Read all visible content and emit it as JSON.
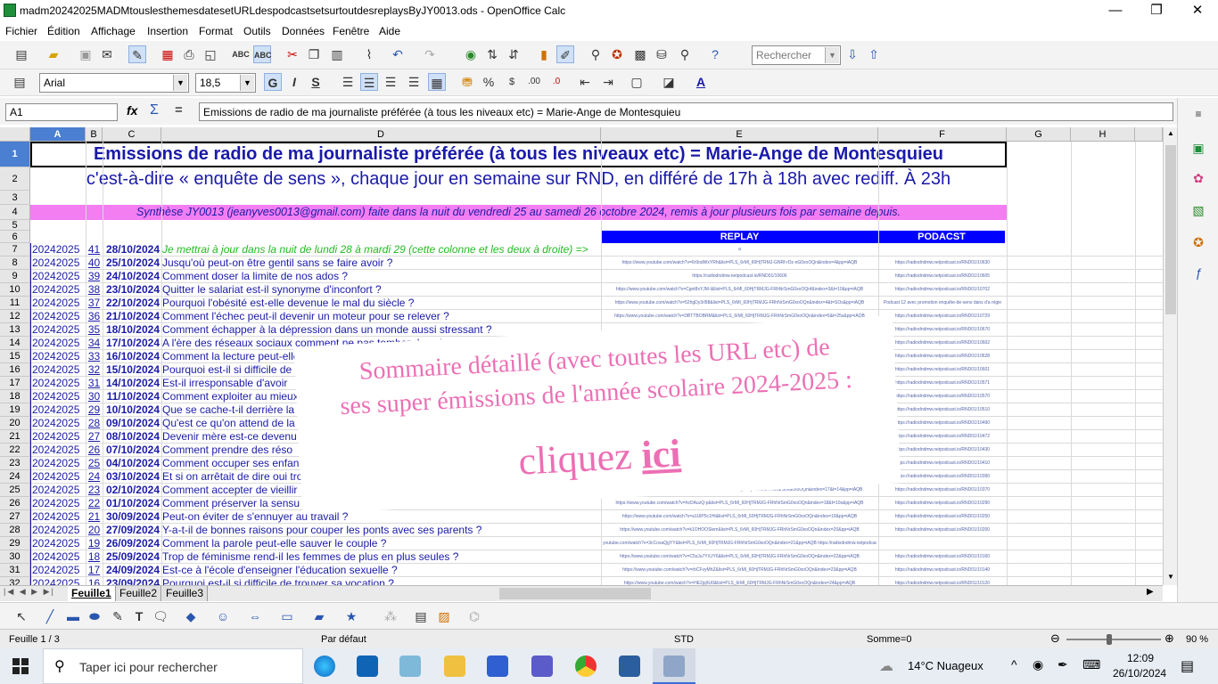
{
  "window": {
    "title": "madm20242025MADMtouslesthemesdatesetURLdespodcastsetsurtoutdesreplaysByJY0013.ods - OpenOffice Calc",
    "minimize": "—",
    "maximize": "❐",
    "close": "✕"
  },
  "menu": [
    "Fichier",
    "Édition",
    "Affichage",
    "Insertion",
    "Format",
    "Outils",
    "Données",
    "Fenêtre",
    "Aide"
  ],
  "toolbar": {
    "search_placeholder": "Rechercher",
    "font_name": "Arial",
    "font_size": "18,5",
    "bold": "G",
    "italic": "I",
    "underline": "S"
  },
  "formula_bar": {
    "cell_ref": "A1",
    "fx_symbol": "fx",
    "sum_symbol": "Σ",
    "equals_symbol": "=",
    "content": "Emissions de radio de ma journaliste préférée (à tous les niveaux etc)  =  Marie-Ange de Montesquieu"
  },
  "columns": [
    "A",
    "B",
    "C",
    "D",
    "E",
    "F",
    "G",
    "H"
  ],
  "sheet": {
    "title": "Emissions de radio de ma journaliste préférée (à tous les niveaux etc)  =  Marie-Ange de Montesquieu",
    "subtitle": "c'est-à-dire « enquête de sens », chaque jour en semaine sur RND, en différé de 17h à 18h avec rediff. À 23h",
    "synthesis": "Synthèse JY0013  (jeanyves0013@gmail.com) faite dans la nuit du vendredi 25 au samedi 26 octobre 2024, remis à jour plusieurs fois par semaine depuis.",
    "replay_header": "REPLAY",
    "podcast_header": "PODACST",
    "rows": [
      {
        "n": "7",
        "year": "20242025",
        "num": "41",
        "date": "28/10/2024",
        "title": "Je mettrai à jour dans la nuit de lundi 28 à mardi 29 (cette colonne et les deux à droite) =>",
        "note": true,
        "replay": "a",
        "podcast": ""
      },
      {
        "n": "8",
        "year": "20242025",
        "num": "40",
        "date": "25/10/2024",
        "title": "Jusqu'où peut-on être gentil sans se faire avoir ?",
        "replay": "https://www.youtube.com/watch?v=6r9odWxYRh&list=PLS_6rMl_60HjTRMJ-GNRf-rDz-nG0xoOQn&index=4&pp=iAQB",
        "podcast": "https://radiodndmw.netpodcast.io/RND01/10630"
      },
      {
        "n": "9",
        "year": "20242025",
        "num": "39",
        "date": "24/10/2024",
        "title": "Comment doser la limite de nos ados ?",
        "replay": "https://radiodndmw.netpodcast.io/RND01/10606",
        "podcast": "https://radiodndmw.netpodcast.io/RND01/10605"
      },
      {
        "n": "10",
        "year": "20242025",
        "num": "38",
        "date": "23/10/2024",
        "title": "Quitter le salariat est-il synonyme d'inconfort ?",
        "replay": "https://www.youtube.com/watch?v=Cgnt8xYJM-I&list=PLS_6rMl_60HjTRMJG-FRhNrSmG0xoOQnf&index=3&t=10&pp=iAQB",
        "podcast": "https://radiodndmw.netpodcast.io/RND01/10702"
      },
      {
        "n": "11",
        "year": "20242025",
        "num": "37",
        "date": "22/10/2024",
        "title": "Pourquoi l'obésité est-elle devenue le mal du siècle ?",
        "replay": "https://www.youtube.com/watch?v=52hgDy3rl98&list=PLS_6rMl_60HjTRMJG-FRhNrSmG0xoOQn&index=4&t=SOs&pp=iAQB",
        "podcast": "Podcast 12 avec promotion enquête-de-sens dans d'a régie"
      },
      {
        "n": "12",
        "year": "20242025",
        "num": "36",
        "date": "21/10/2024",
        "title": "Comment l'échec peut-il devenir un moteur pour se relever ?",
        "replay": "https://www.youtube.com/watch?v=DBTTBOBRM&list=PLS_6rMl_60HjTRMJG-FRhNrSmG0xoOQn&index=5&t=25s&pp=iAQB",
        "podcast": "https://radiodndmw.netpodcast.io/RND01/10729"
      },
      {
        "n": "13",
        "year": "20242025",
        "num": "35",
        "date": "18/10/2024",
        "title": "Comment échapper à la dépression dans un monde aussi stressant ?",
        "replay": "https://www.youtube.com/watch?v=uNtPRGkoM",
        "podcast": "https://radiodndmw.netpodcast.io/RND01/10670"
      },
      {
        "n": "14",
        "year": "20242025",
        "num": "34",
        "date": "17/10/2024",
        "title": "A l'ère des réseaux sociaux comment ne pas tomber dans le tribunal médiatique ?",
        "replay": "",
        "podcast": "https://radiodndmw.netpodcast.io/RND01/10602"
      },
      {
        "n": "15",
        "year": "20242025",
        "num": "33",
        "date": "16/10/2024",
        "title": "Comment la lecture peut-elle rendre nos enfants",
        "replay": "",
        "podcast": "https://radiodndmw.netpodcast.io/RND01/10628"
      },
      {
        "n": "16",
        "year": "20242025",
        "num": "32",
        "date": "15/10/2024",
        "title": "Pourquoi est-il si difficile de",
        "replay": "",
        "podcast": "https://radiodndmw.netpodcast.io/RND01/10601"
      },
      {
        "n": "17",
        "year": "20242025",
        "num": "31",
        "date": "14/10/2024",
        "title": "Est-il irresponsable d'avoir",
        "replay": "",
        "podcast": "https://radiodndmw.netpodcast.io/RND01/10571"
      },
      {
        "n": "18",
        "year": "20242025",
        "num": "30",
        "date": "11/10/2024",
        "title": "Comment exploiter au mieux",
        "replay": "",
        "podcast": "https://radiodndmw.netpodcast.io/RND01/10570"
      },
      {
        "n": "19",
        "year": "20242025",
        "num": "29",
        "date": "10/10/2024",
        "title": "Que se cache-t-il derrière la",
        "replay": "",
        "podcast": "https://radiodndmw.netpodcast.io/RND01/10510"
      },
      {
        "n": "20",
        "year": "20242025",
        "num": "28",
        "date": "09/10/2024",
        "title": "Qu'est ce qu'on attend de la",
        "replay": "",
        "podcast": "https://radiodndmw.netpodcast.io/RND01/10490"
      },
      {
        "n": "21",
        "year": "20242025",
        "num": "27",
        "date": "08/10/2024",
        "title": "Devenir mère est-ce devenu",
        "replay": "",
        "podcast": "https://radiodndmw.netpodcast.io/RND01/10472"
      },
      {
        "n": "22",
        "year": "20242025",
        "num": "26",
        "date": "07/10/2024",
        "title": "Comment prendre des réso",
        "replay": "",
        "podcast": "https://radiodndmw.netpodcast.io/RND01/10430"
      },
      {
        "n": "23",
        "year": "20242025",
        "num": "25",
        "date": "04/10/2024",
        "title": "Comment occuper ses enfan",
        "replay": "",
        "podcast": "https://radiodndmw.netpodcast.io/RND01/10410"
      },
      {
        "n": "24",
        "year": "20242025",
        "num": "24",
        "date": "03/10/2024",
        "title": "Et si on arrêtait de dire oui tro",
        "replay": "",
        "podcast": "https://radiodndmw.netpodcast.io/RND01/10390"
      },
      {
        "n": "25",
        "year": "20242025",
        "num": "23",
        "date": "02/10/2024",
        "title": "Comment accepter de vieillir",
        "replay": "https://www.youtube.com/watch?v=gaKCDBBK&list=PLS_6rMl_60HjTRMJG-FRhNrSmG0xoOQn&index=17&t=14&pp=iAQB",
        "podcast": "https://radiodndmw.netpodcast.io/RND01/10370"
      },
      {
        "n": "26",
        "year": "20242025",
        "num": "22",
        "date": "01/10/2024",
        "title": "Comment préserver la sensu",
        "replay": "https://www.youtube.com/watch?v=hcDAuzQ-p&list=PLS_6rMl_60HjTRMJG-FRhNrSmG0xoOQn&index=18&t=10s&pp=iAQB",
        "podcast": "https://radiodndmw.netpodcast.io/RND01/10290"
      },
      {
        "n": "27",
        "year": "20242025",
        "num": "21",
        "date": "30/09/2024",
        "title": "Peut-on éviter de s'ennuyer au travail ?",
        "replay": "https://www.youtube.com/watch?v=a1UlP5c1Ht&list=PLS_6rMl_60HjTRMJG-FRhNrSmG0xoOQn&index=19&pp=iAQB",
        "podcast": "https://radiodndmw.netpodcast.io/RND01/10250"
      },
      {
        "n": "28",
        "year": "20242025",
        "num": "20",
        "date": "27/09/2024",
        "title": "Y-a-t-il de bonnes raisons pour couper les ponts avec ses parents ?",
        "replay": "https://www.youtube.com/watch?v=k1OHOOSlem&list=PLS_6rMl_60HjTRMJG-FRhNrSmG0xoOQn&index=20&pp=iAQB",
        "podcast": "https://radiodndmw.netpodcast.io/RND01/10200"
      },
      {
        "n": "29",
        "year": "20242025",
        "num": "19",
        "date": "26/09/2024",
        "title": "Comment la parole peut-elle sauver le couple ?",
        "replay": "youtube.com/watch?v=3cCosaQgYY&list=PLS_6rMl_60HjTRMJG-FRhNrSmG0xoOQn&index=21&pp=iAQB https://radiodndmw.netpodcast",
        "podcast": ""
      },
      {
        "n": "30",
        "year": "20242025",
        "num": "18",
        "date": "25/09/2024",
        "title": "Trop de féminisme rend-il les femmes de plus en plus seules ?",
        "replay": "https://www.youtube.com/watch?v=C5sJu7YXJY6&list=PLS_6rMl_60HjTRMJG-FRhNrSmG0xoOQn&index=22&pp=iAQB",
        "podcast": "https://radiodndmw.netpodcast.io/RND01/10160"
      },
      {
        "n": "31",
        "year": "20242025",
        "num": "17",
        "date": "24/09/2024",
        "title": "Est-ce à l'école d'enseigner l'éducation sexuelle ?",
        "replay": "https://www.youtube.com/watch?v=rbCFvyMhZ&list=PLS_6rMl_60HjTRMJG-FRhNrSmG0xoOQn&index=23&pp=iAQB",
        "podcast": "https://radiodndmw.netpodcast.io/RND01/10140"
      },
      {
        "n": "32",
        "year": "20242025",
        "num": "16",
        "date": "23/09/2024",
        "title": "Pourquoi est-il si difficile de trouver sa vocation ?",
        "replay": "https://www.youtube.com/watch?v=HE2jq9U0&list=PLS_6rMl_60HjTRMJG-FRhNrSmG0xoOQn&index=24&pp=iAQB",
        "podcast": "https://radiodndmw.netpodcast.io/RND01/10120"
      }
    ]
  },
  "overlay": {
    "line1": "Sommaire détaillé (avec toutes les URL etc) de",
    "line2": "ses super émissions de l'année scolaire 2024-2025 :",
    "cta_prefix": "cliquez ",
    "cta_link": "ici"
  },
  "sheet_tabs": [
    "Feuille1",
    "Feuille2",
    "Feuille3"
  ],
  "status": {
    "sheet": "Feuille 1 / 3",
    "style": "Par défaut",
    "mode": "STD",
    "sum": "Somme=0",
    "zoom": "90 %",
    "zoom_value": 0.9
  },
  "taskbar": {
    "search_placeholder": "Taper ici pour rechercher",
    "weather": "14°C  Nuageux",
    "time": "12:09",
    "date": "26/10/2024"
  },
  "colors": {
    "title_blue": "#1a1aa8",
    "pink_band": "#f27ef2",
    "header_blue": "#0000ff",
    "note_green": "#22bb22",
    "overlay_pink": "#ec6fb4"
  }
}
